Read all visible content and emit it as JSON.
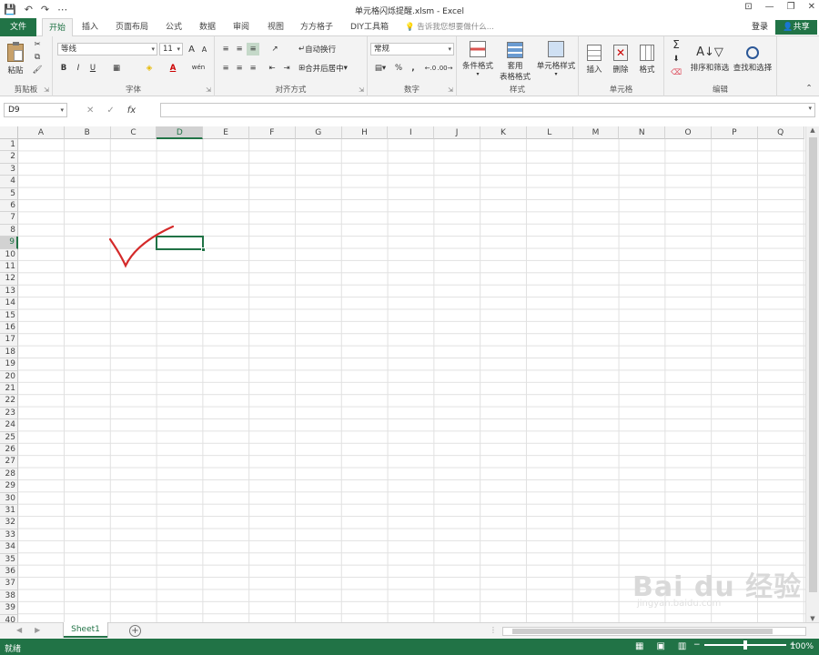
{
  "window": {
    "title": "单元格闪烁提醒.xlsm - Excel"
  },
  "qat": {
    "save": "💾",
    "undo": "↶",
    "redo": "↷",
    "customize": "⋯"
  },
  "winctl": {
    "ribbon_opts": "⊡",
    "minimize": "—",
    "restore": "❐",
    "close": "✕"
  },
  "tabs": [
    {
      "label": "文件"
    },
    {
      "label": "开始"
    },
    {
      "label": "插入"
    },
    {
      "label": "页面布局"
    },
    {
      "label": "公式"
    },
    {
      "label": "数据"
    },
    {
      "label": "审阅"
    },
    {
      "label": "视图"
    },
    {
      "label": "方方格子"
    },
    {
      "label": "DIY工具箱"
    }
  ],
  "tellme": "告诉我您想要做什么...",
  "account": {
    "login": "登录",
    "share": "共享"
  },
  "ribbon": {
    "clipboard": {
      "label": "剪贴板",
      "paste": "粘贴"
    },
    "font": {
      "label": "字体",
      "name": "等线",
      "size": "11",
      "bold": "B",
      "italic": "I",
      "underline": "U",
      "grow": "A",
      "shrink": "A",
      "wen": "wén"
    },
    "align": {
      "label": "对齐方式",
      "wrap": "自动换行",
      "merge": "合并后居中"
    },
    "number": {
      "label": "数字",
      "format": "常规",
      "percent": "%",
      "comma": ","
    },
    "styles": {
      "label": "样式",
      "cond": "条件格式",
      "table": "套用",
      "table2": "表格格式",
      "cell": "单元格样式"
    },
    "cells": {
      "label": "单元格",
      "insert": "插入",
      "delete": "删除",
      "format": "格式"
    },
    "editing": {
      "label": "编辑",
      "sort": "排序和筛选",
      "find": "查找和选择",
      "sum": "Σ"
    }
  },
  "formula": {
    "namebox": "D9",
    "fx": "fx",
    "cancel": "✕",
    "enter": "✓",
    "value": ""
  },
  "columns": [
    "A",
    "B",
    "C",
    "D",
    "E",
    "F",
    "G",
    "H",
    "I",
    "J",
    "K",
    "L",
    "M",
    "N",
    "O",
    "P",
    "Q"
  ],
  "rows": [
    "1",
    "2",
    "3",
    "4",
    "5",
    "6",
    "7",
    "8",
    "9",
    "10",
    "11",
    "12",
    "13",
    "14",
    "15",
    "16",
    "17",
    "18",
    "19",
    "20",
    "21",
    "22",
    "23",
    "24",
    "25",
    "26",
    "27",
    "28",
    "29",
    "30",
    "31",
    "32",
    "33",
    "34",
    "35",
    "36",
    "37",
    "38",
    "39",
    "40"
  ],
  "selected": {
    "col": "D",
    "row": "9"
  },
  "sheets": [
    {
      "name": "Sheet1"
    }
  ],
  "status": {
    "ready": "就绪",
    "zoom": "100%",
    "zoom_level": 100
  },
  "colors": {
    "accent": "#217346",
    "check": "#d42a2a"
  },
  "watermark": {
    "brand": "Bai du 经验",
    "url": "jingyan.baidu.com"
  }
}
